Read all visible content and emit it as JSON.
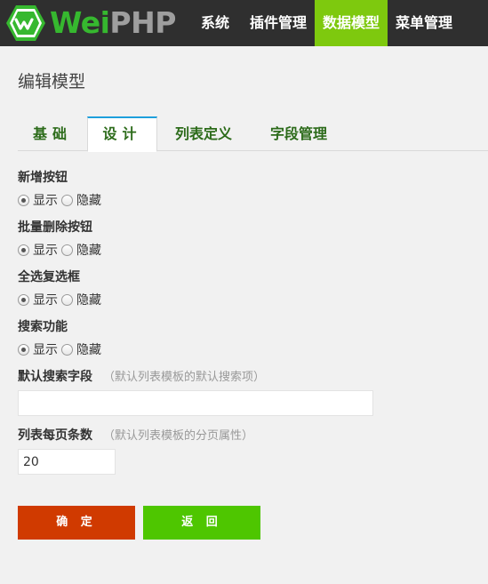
{
  "header": {
    "logo_wei": "Wei",
    "logo_php": "PHP",
    "nav": [
      "系统",
      "插件管理",
      "数据模型",
      "菜单管理"
    ]
  },
  "page_title": "编辑模型",
  "tabs": [
    "基础",
    "设计",
    "列表定义",
    "字段管理"
  ],
  "form": {
    "add_button": {
      "label": "新增按钮",
      "options": [
        "显示",
        "隐藏"
      ],
      "selected": "显示"
    },
    "batch_delete": {
      "label": "批量删除按钮",
      "options": [
        "显示",
        "隐藏"
      ],
      "selected": "显示"
    },
    "select_all": {
      "label": "全选复选框",
      "options": [
        "显示",
        "隐藏"
      ],
      "selected": "显示"
    },
    "search": {
      "label": "搜索功能",
      "options": [
        "显示",
        "隐藏"
      ],
      "selected": "显示"
    },
    "default_search_field": {
      "label": "默认搜索字段",
      "hint": "（默认列表模板的默认搜索项）",
      "value": ""
    },
    "page_size": {
      "label": "列表每页条数",
      "hint": "（默认列表模板的分页属性）",
      "value": "20"
    }
  },
  "buttons": {
    "ok": "确 定",
    "back": "返 回"
  },
  "colors": {
    "header_bg": "#2f2f2f",
    "nav_active": "#7ec90e",
    "tab_active_top": "#1e9fdc",
    "btn_ok": "#d03a00",
    "btn_back": "#4ec600"
  }
}
